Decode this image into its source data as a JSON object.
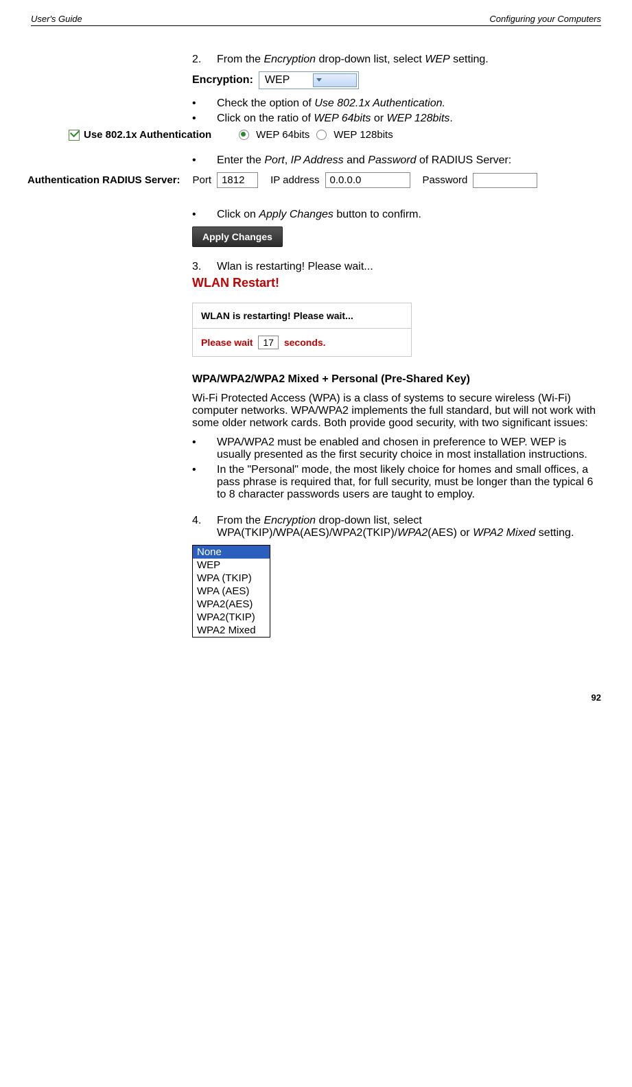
{
  "header": {
    "left": "User's Guide",
    "right": "Configuring your Computers"
  },
  "step2": {
    "num": "2.",
    "text_a": "From the ",
    "em1": "Encryption",
    "text_b": " drop-down list, select ",
    "em2": "WEP",
    "text_c": " setting."
  },
  "encryption_dd": {
    "label": "Encryption:",
    "value": "WEP"
  },
  "bullets1": {
    "b1a": "Check the option of ",
    "b1em": "Use 802.1x Authentication.",
    "b2a": "Click on the ratio of ",
    "b2em1": "WEP 64bits",
    "b2mid": " or ",
    "b2em2": "WEP 128bits",
    "b2end": "."
  },
  "authrow": {
    "chk_label": "Use 802.1x Authentication",
    "radio1": "WEP 64bits",
    "radio2": "WEP 128bits"
  },
  "bullets2": {
    "a": "Enter the ",
    "em1": "Port",
    "c1": ", ",
    "em2": "IP Address",
    "c2": " and ",
    "em3": "Password",
    "end": " of RADIUS Server:"
  },
  "radius": {
    "label": "Authentication RADIUS Server:",
    "port_label": "Port",
    "port_value": "1812",
    "ip_label": "IP address",
    "ip_value": "0.0.0.0",
    "pw_label": "Password"
  },
  "bullets3": {
    "a": "Click on ",
    "em": "Apply Changes",
    "end": " button to confirm."
  },
  "apply_label": "Apply Changes",
  "step3": {
    "num": "3.",
    "text": "Wlan is restarting! Please wait..."
  },
  "wlan": {
    "title": "WLAN Restart!",
    "line1": "WLAN is restarting! Please wait...",
    "wait_a": "Please wait",
    "wait_num": "17",
    "wait_b": "seconds."
  },
  "wpa_title": "WPA/WPA2/WPA2 Mixed + Personal (Pre-Shared Key)",
  "wpa_para": "Wi-Fi Protected Access (WPA) is a class of systems to secure wireless (Wi-Fi) computer networks. WPA/WPA2 implements the full standard, but will not work with some older network cards. Both provide good security, with two significant issues:",
  "wpa_b1": "WPA/WPA2 must be enabled and chosen in preference to WEP. WEP is usually presented as the first security choice in most installation instructions.",
  "wpa_b2": "In the \"Personal\" mode, the most likely choice for homes and small offices, a pass phrase is required that, for full security, must be longer than the typical 6 to 8 character passwords users are taught to employ.",
  "step4": {
    "num": "4.",
    "a": "From the ",
    "em1": "Encryption",
    "b": " drop-down list, select WPA(TKIP)/WPA(AES)/WPA2(TKIP)/",
    "em2": "WPA2",
    "c": "(AES) or ",
    "em3": "WPA2 Mixed",
    "d": " setting."
  },
  "menu": {
    "m0": "None",
    "m1": "WEP",
    "m2": "WPA (TKIP)",
    "m3": "WPA (AES)",
    "m4": "WPA2(AES)",
    "m5": "WPA2(TKIP)",
    "m6": "WPA2 Mixed"
  },
  "page_number": "92"
}
